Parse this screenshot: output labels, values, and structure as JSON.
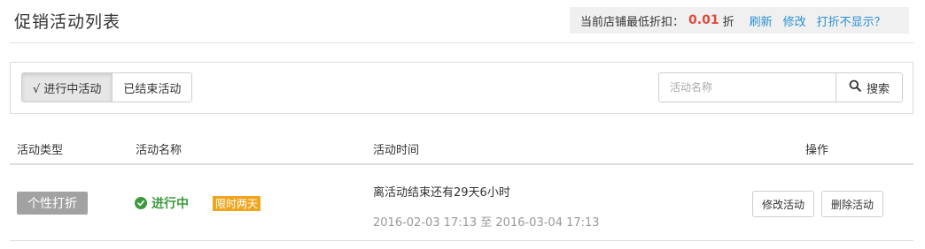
{
  "header": {
    "title": "促销活动列表",
    "min_discount_label": "当前店铺最低折扣：",
    "min_discount_value": "0.01",
    "min_discount_unit": "折",
    "refresh_link": "刷新",
    "edit_link": "修改",
    "not_shown_link": "打折不显示？"
  },
  "filter": {
    "tabs": [
      {
        "label": "√ 进行中活动",
        "active": true
      },
      {
        "label": "已结束活动",
        "active": false
      }
    ],
    "search_placeholder": "活动名称",
    "search_button": "搜索"
  },
  "table": {
    "columns": [
      "活动类型",
      "活动名称",
      "活动时间",
      "操作"
    ],
    "rows": [
      {
        "type": "个性打折",
        "status": "进行中",
        "tag": "限时两天",
        "remaining": "离活动结束还有29天6小时",
        "time_range": "2016-02-03 17:13 至 2016-03-04 17:13",
        "actions": [
          "修改活动",
          "删除活动"
        ]
      }
    ]
  },
  "colors": {
    "accent_link": "#2a8fd4",
    "discount_red": "#e24a3b",
    "status_green": "#3c9a3c",
    "tag_orange": "#f0a51e",
    "badge_gray": "#a2a2a2"
  }
}
